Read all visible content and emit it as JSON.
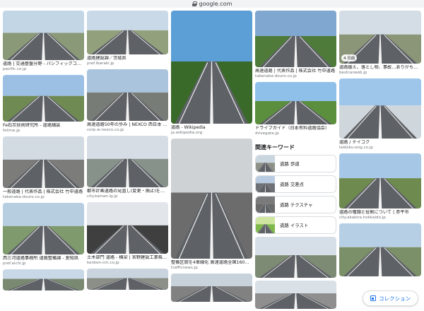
{
  "browser": {
    "url": "google.com"
  },
  "columns": [
    [
      {
        "title": "道路 | 交通基盤分野 - パシフィックコンサ...",
        "source": "pacific.co.jp",
        "sky": "#c3d6e6",
        "ground": "#8a9a78",
        "h": 70
      },
      {
        "title": "Fe石灰技術研究所 - 道路舗装",
        "source": "felime.jp",
        "sky": "#9cc0e4",
        "ground": "#6f8a52",
        "h": 66
      },
      {
        "title": "一般道路 | 代表作品 | 株式会社 竹中道路",
        "source": "takenaka-douro.co.jp",
        "sky": "#d2dae2",
        "ground": "#7c7d7a",
        "h": 73
      },
      {
        "title": "西三河道路事務所 道路整備課 - 愛知県",
        "source": "pref.aichi.jp",
        "sky": "#b7cde0",
        "ground": "#7f9a6c",
        "h": 73
      },
      {
        "title": "",
        "source": "",
        "sky": "#c8d8e6",
        "ground": "#7a8a72",
        "h": 30
      }
    ],
    [
      {
        "title": "道路建設課／茨城県",
        "source": "pref.ibaraki.jp",
        "sky": "#c9d9e7",
        "ground": "#93a07c",
        "h": 62
      },
      {
        "title": "高速道路50年の歩み | NEXCO 西日本 企業...",
        "source": "corp.w-nexco.co.jp",
        "sky": "#a9c4dc",
        "ground": "#777d76",
        "h": 73
      },
      {
        "title": "都市計画道路の見直し(変更・廃止)を行い...",
        "source": "city.kainan.lg.jp",
        "sky": "#d7dde4",
        "ground": "#86928a",
        "h": 73
      },
      {
        "title": "土木部門 道路 - 横梁 | 宮野建設工業株式...",
        "source": "kenken-cm.co.jp",
        "sky": "#e2e6ea",
        "ground": "#3f3f3f",
        "h": 73
      },
      {
        "title": "",
        "source": "",
        "sky": "#c9d4de",
        "ground": "#8b8f88",
        "h": 30
      }
    ],
    [
      {
        "title": "道路 - Wikipedia",
        "source": "ja.wikipedia.org",
        "sky": "#5c9ed6",
        "ground": "#3a6a2a",
        "h": 160
      },
      {
        "title": "整備区間を4車線化 高速道路全国160か所...",
        "source": "trafficnews.jp",
        "sky": "#cfd2d5",
        "ground": "#6c6c6c",
        "h": 170
      },
      {
        "title": "",
        "source": "",
        "sky": "#c8d2da",
        "ground": "#818181",
        "h": 40
      }
    ],
    [
      {
        "title": "高速道路 | 代表作品 | 株式会社 竹中道路",
        "source": "takenaka-douro.co.jp",
        "sky": "#7fa7cf",
        "ground": "#4e7b3a",
        "h": 80
      },
      {
        "title": "ドライブガイド（日本有料道路協会）",
        "source": "drivegate.jp",
        "sky": "#8fc0ea",
        "ground": "#5b8f3d",
        "h": 60
      }
    ],
    [
      {
        "title": "道路鍛え、落とし物、事故…ありがちトラ...",
        "source": "bestcarweb.jp",
        "sky": "#d4dde5",
        "ground": "#8b9577",
        "h": 75,
        "badge": "4 日前"
      },
      {
        "title": "道路 / テイコク",
        "source": "teikoku-eng.co.jp",
        "sky": "#9ec6ea",
        "ground": "#cfd6dc",
        "h": 85
      },
      {
        "title": "道路の種類と役割について | 赤平市",
        "source": "city.akabira.hokkaido.jp",
        "sky": "#a7c7e6",
        "ground": "#6e8a4e",
        "h": 78
      },
      {
        "title": "",
        "source": "",
        "sky": "#b6cfe4",
        "ground": "#7b8f68",
        "h": 75
      }
    ]
  ],
  "related": {
    "heading": "関連キーワード",
    "chips": [
      {
        "label": "道路 歩道",
        "sky": "#c9d6e0",
        "ground": "#8d9187"
      },
      {
        "label": "道路 交差点",
        "sky": "#b8cbe0",
        "ground": "#6e7277"
      },
      {
        "label": "道路 テクスチャ",
        "sky": "#7a7a7a",
        "ground": "#6a6a6a"
      },
      {
        "label": "道路 イラスト",
        "sky": "#cfe6a0",
        "ground": "#7fb84a"
      }
    ]
  },
  "col4_after": [
    {
      "title": "",
      "source": "",
      "sky": "#d6dfe8",
      "ground": "#7d8a74",
      "h": 58
    },
    {
      "title": "",
      "source": "",
      "sky": "#d9e0e6",
      "ground": "#8f8f8f",
      "h": 40
    }
  ],
  "collection_button": {
    "label": "コレクション"
  }
}
